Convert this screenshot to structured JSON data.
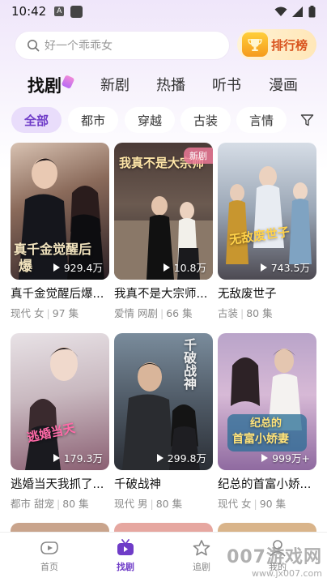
{
  "status": {
    "time": "10:42",
    "a_label": "A"
  },
  "search": {
    "placeholder": "好一个乖乖女"
  },
  "rank": {
    "label": "排行榜"
  },
  "main_tabs": [
    "找剧",
    "新剧",
    "热播",
    "听书",
    "漫画"
  ],
  "filters": [
    "全部",
    "都市",
    "穿越",
    "古装",
    "言情"
  ],
  "cards": [
    {
      "title": "真千金觉醒后爆...",
      "tag1": "现代",
      "tag2": "女",
      "episodes": "97 集",
      "plays": "929.4万",
      "art": "真千金觉醒后",
      "art2": "爆",
      "badge": ""
    },
    {
      "title": "我真不是大宗师...",
      "tag1": "爱情",
      "tag2": "网剧",
      "episodes": "66 集",
      "plays": "10.8万",
      "art": "我真不是大宗师",
      "art2": "",
      "badge": "新剧"
    },
    {
      "title": "无敌废世子",
      "tag1": "古装",
      "tag2": "",
      "episodes": "80 集",
      "plays": "743.5万",
      "art": "无敌废世子",
      "art2": "",
      "badge": ""
    },
    {
      "title": "逃婚当天我抓了...",
      "tag1": "都市",
      "tag2": "甜宠",
      "episodes": "80 集",
      "plays": "179.3万",
      "art": "逃婚当天",
      "art2": "",
      "badge": ""
    },
    {
      "title": "千破战神",
      "tag1": "现代",
      "tag2": "男",
      "episodes": "80 集",
      "plays": "299.8万",
      "art": "千破战神",
      "art2": "",
      "badge": ""
    },
    {
      "title": "纪总的首富小娇...",
      "tag1": "现代",
      "tag2": "女",
      "episodes": "90 集",
      "plays": "999万+",
      "art": "纪总的",
      "art2": "首富小娇妻",
      "badge": ""
    }
  ],
  "nav": [
    {
      "label": "首页",
      "icon": "home-icon"
    },
    {
      "label": "找剧",
      "icon": "tv-icon"
    },
    {
      "label": "追剧",
      "icon": "star-icon"
    },
    {
      "label": "我的",
      "icon": "profile-icon"
    }
  ],
  "watermark": {
    "main": "007游戏网",
    "sub": "www.jx007.com"
  },
  "colors": {
    "accent": "#6f3cc8",
    "chip_active_bg": "#e9ddfb",
    "rank_text": "#d9531e"
  }
}
